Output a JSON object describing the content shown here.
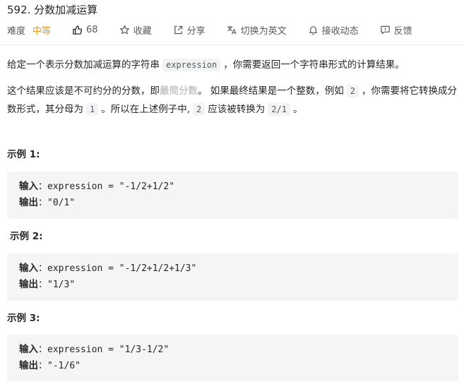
{
  "header": {
    "title": "592. 分数加减运算"
  },
  "toolbar": {
    "difficulty_label": "难度",
    "difficulty_value": "中等",
    "like_count": "68",
    "favorite_label": "收藏",
    "share_label": "分享",
    "translate_label": "切换为英文",
    "subscribe_label": "接收动态",
    "feedback_label": "反馈",
    "difficulty_color": "#ef9a22"
  },
  "description": {
    "p1_before": "给定一个表示分数加减运算的字符串",
    "p1_code": "expression",
    "p1_after": "，你需要返回一个字符串形式的计算结果。",
    "p2_part1": "这个结果应该是不可约分的分数，即",
    "p2_highlight": "最简分数",
    "p2_part2": "。 如果最终结果是一个整数，例如",
    "p2_code1": "2",
    "p2_part3": "，你需要将它转换成分数形式，其分母为",
    "p2_code2": "1",
    "p2_part4": "。所以在上述例子中,",
    "p2_code3": "2",
    "p2_part5": "应该被转换为",
    "p2_code4": "2/1",
    "p2_part6": "。"
  },
  "examples": [
    {
      "label": "示例 1:",
      "input_key": "输入",
      "input_value": "expression = \"-1/2+1/2\"",
      "output_key": "输出",
      "output_value": "\"0/1\""
    },
    {
      "label": "示例 2:",
      "input_key": "输入",
      "input_value": "expression = \"-1/2+1/2+1/3\"",
      "output_key": "输出",
      "output_value": "\"1/3\""
    },
    {
      "label": "示例 3:",
      "input_key": "输入",
      "input_value": "expression = \"1/3-1/2\"",
      "output_key": "输出",
      "output_value": "\"-1/6\""
    }
  ],
  "icons": {
    "like": "thumbs-up-icon",
    "favorite": "star-icon",
    "share": "share-icon",
    "translate": "translate-icon",
    "subscribe": "bell-icon",
    "feedback": "feedback-icon"
  }
}
